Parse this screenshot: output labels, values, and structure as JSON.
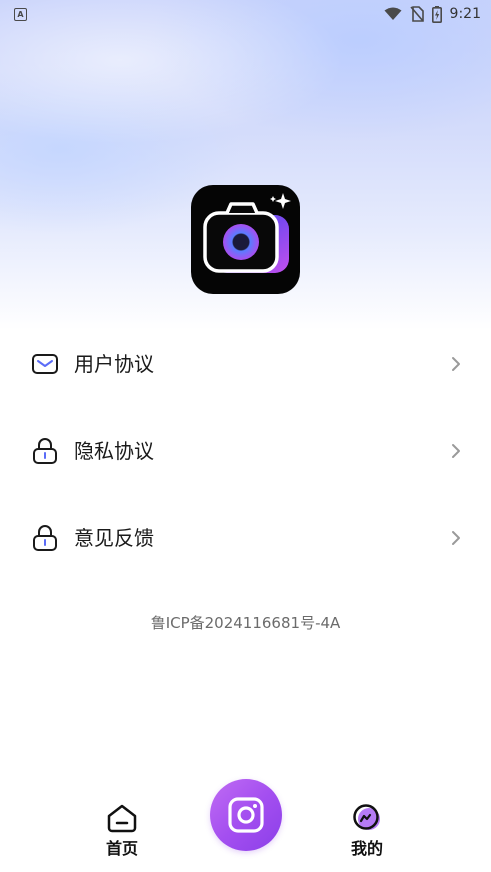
{
  "status_bar": {
    "time": "9:21",
    "left_icon": "notification-a-icon",
    "left_icon_text": "A",
    "icons": [
      "wifi-icon",
      "no-sim-icon",
      "battery-charging-icon"
    ]
  },
  "app": {
    "logo_icon": "camera-app-logo-icon"
  },
  "menu": {
    "items": [
      {
        "label": "用户协议",
        "icon": "envelope-icon"
      },
      {
        "label": "隐私协议",
        "icon": "lock-icon"
      },
      {
        "label": "意见反馈",
        "icon": "lock-icon"
      }
    ]
  },
  "footer": {
    "icp": "鲁ICP备2024116681号-4A"
  },
  "tabbar": {
    "tabs": [
      {
        "label": "首页",
        "icon": "home-icon",
        "active": false
      },
      {
        "label": "",
        "icon": "camera-icon",
        "active": false
      },
      {
        "label": "我的",
        "icon": "profile-icon",
        "active": true
      }
    ]
  },
  "colors": {
    "accent": "#a855f7",
    "logo_blue": "#4a6cf7",
    "text": "#1a1a1a",
    "muted": "#6b6b6b"
  }
}
